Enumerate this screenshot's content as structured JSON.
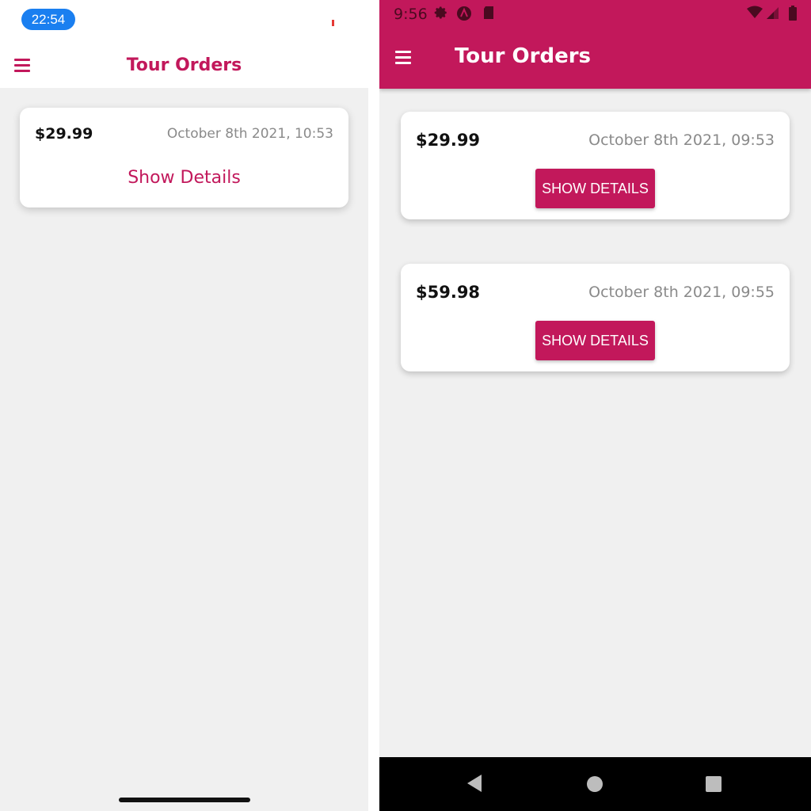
{
  "ios": {
    "status": {
      "time": "22:54"
    },
    "header": {
      "title": "Tour Orders",
      "menu_icon": "hamburger-menu-icon"
    },
    "orders": [
      {
        "price": "$29.99",
        "date": "October 8th 2021, 10:53",
        "action_label": "Show Details"
      }
    ]
  },
  "android": {
    "status": {
      "time": "9:56",
      "icons": [
        "settings-icon",
        "app-a-icon",
        "sd-card-icon",
        "wifi-icon",
        "signal-icon",
        "battery-icon"
      ]
    },
    "header": {
      "title": "Tour Orders",
      "menu_icon": "hamburger-menu-icon"
    },
    "orders": [
      {
        "price": "$29.99",
        "date": "October 8th 2021, 09:53",
        "action_label": "SHOW DETAILS"
      },
      {
        "price": "$59.98",
        "date": "October 8th 2021, 09:55",
        "action_label": "SHOW DETAILS"
      }
    ],
    "nav": {
      "back_icon": "back-triangle-icon",
      "home_icon": "home-circle-icon",
      "recents_icon": "recents-square-icon"
    }
  },
  "colors": {
    "primary": "#c2185b",
    "background": "#f0f0f0",
    "ios_time_pill": "#1a7ff0"
  }
}
